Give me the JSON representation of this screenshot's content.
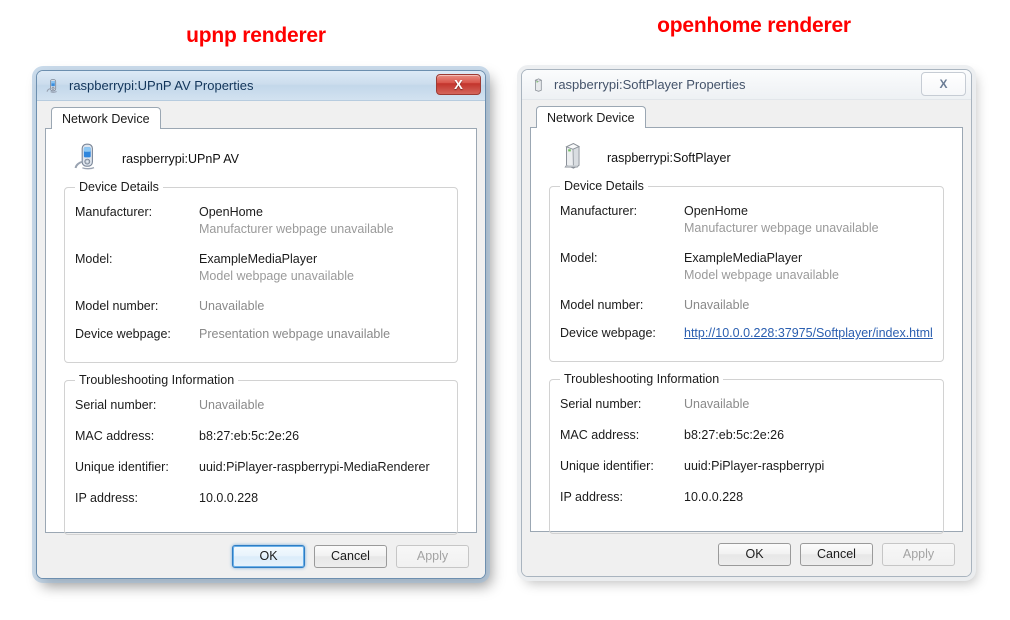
{
  "captions": {
    "left": "upnp renderer",
    "right": "openhome renderer",
    "color": "#ff0000"
  },
  "dialogs": [
    {
      "id": "upnp-av",
      "state": "active",
      "titlebar": {
        "title": "raspberrypi:UPnP AV Properties",
        "icon": "media-player-device-icon",
        "close_label": "X",
        "close_style": "red"
      },
      "tab": {
        "label": "Network Device"
      },
      "device_header": {
        "icon": "media-player-device-icon",
        "name": "raspberrypi:UPnP AV"
      },
      "device_details": {
        "legend": "Device Details",
        "rows": [
          {
            "label": "Manufacturer:",
            "value": "OpenHome",
            "muted": false,
            "sub": "Manufacturer webpage unavailable",
            "link": null
          },
          {
            "label": "Model:",
            "value": "ExampleMediaPlayer",
            "muted": false,
            "sub": "Model webpage unavailable",
            "link": null
          },
          {
            "label": "Model number:",
            "value": "Unavailable",
            "muted": true,
            "sub": null,
            "link": null
          },
          {
            "label": "Device webpage:",
            "value": "Presentation webpage unavailable",
            "muted": true,
            "sub": null,
            "link": null
          }
        ]
      },
      "troubleshooting": {
        "legend": "Troubleshooting Information",
        "rows": [
          {
            "label": "Serial number:",
            "value": "Unavailable",
            "muted": true
          },
          {
            "label": "MAC address:",
            "value": "b8:27:eb:5c:2e:26",
            "muted": false
          },
          {
            "label": "Unique identifier:",
            "value": "uuid:PiPlayer-raspberrypi-MediaRenderer",
            "muted": false
          },
          {
            "label": "IP address:",
            "value": "10.0.0.228",
            "muted": false
          }
        ]
      },
      "buttons": {
        "ok": {
          "label": "OK",
          "focused": true,
          "disabled": false
        },
        "cancel": {
          "label": "Cancel",
          "focused": false,
          "disabled": false
        },
        "apply": {
          "label": "Apply",
          "focused": false,
          "disabled": true
        }
      }
    },
    {
      "id": "softplayer",
      "state": "inactive",
      "titlebar": {
        "title": "raspberrypi:SoftPlayer Properties",
        "icon": "server-tower-device-icon",
        "close_label": "X",
        "close_style": "pale"
      },
      "tab": {
        "label": "Network Device"
      },
      "device_header": {
        "icon": "server-tower-device-icon",
        "name": "raspberrypi:SoftPlayer"
      },
      "device_details": {
        "legend": "Device Details",
        "rows": [
          {
            "label": "Manufacturer:",
            "value": "OpenHome",
            "muted": false,
            "sub": "Manufacturer webpage unavailable",
            "link": null
          },
          {
            "label": "Model:",
            "value": "ExampleMediaPlayer",
            "muted": false,
            "sub": "Model webpage unavailable",
            "link": null
          },
          {
            "label": "Model number:",
            "value": "Unavailable",
            "muted": true,
            "sub": null,
            "link": null
          },
          {
            "label": "Device webpage:",
            "value": null,
            "muted": false,
            "sub": null,
            "link": "http://10.0.0.228:37975/Softplayer/index.html"
          }
        ]
      },
      "troubleshooting": {
        "legend": "Troubleshooting Information",
        "rows": [
          {
            "label": "Serial number:",
            "value": "Unavailable",
            "muted": true
          },
          {
            "label": "MAC address:",
            "value": "b8:27:eb:5c:2e:26",
            "muted": false
          },
          {
            "label": "Unique identifier:",
            "value": "uuid:PiPlayer-raspberrypi",
            "muted": false
          },
          {
            "label": "IP address:",
            "value": "10.0.0.228",
            "muted": false
          }
        ]
      },
      "buttons": {
        "ok": {
          "label": "OK",
          "focused": false,
          "disabled": false
        },
        "cancel": {
          "label": "Cancel",
          "focused": false,
          "disabled": false
        },
        "apply": {
          "label": "Apply",
          "focused": false,
          "disabled": true
        }
      }
    }
  ]
}
